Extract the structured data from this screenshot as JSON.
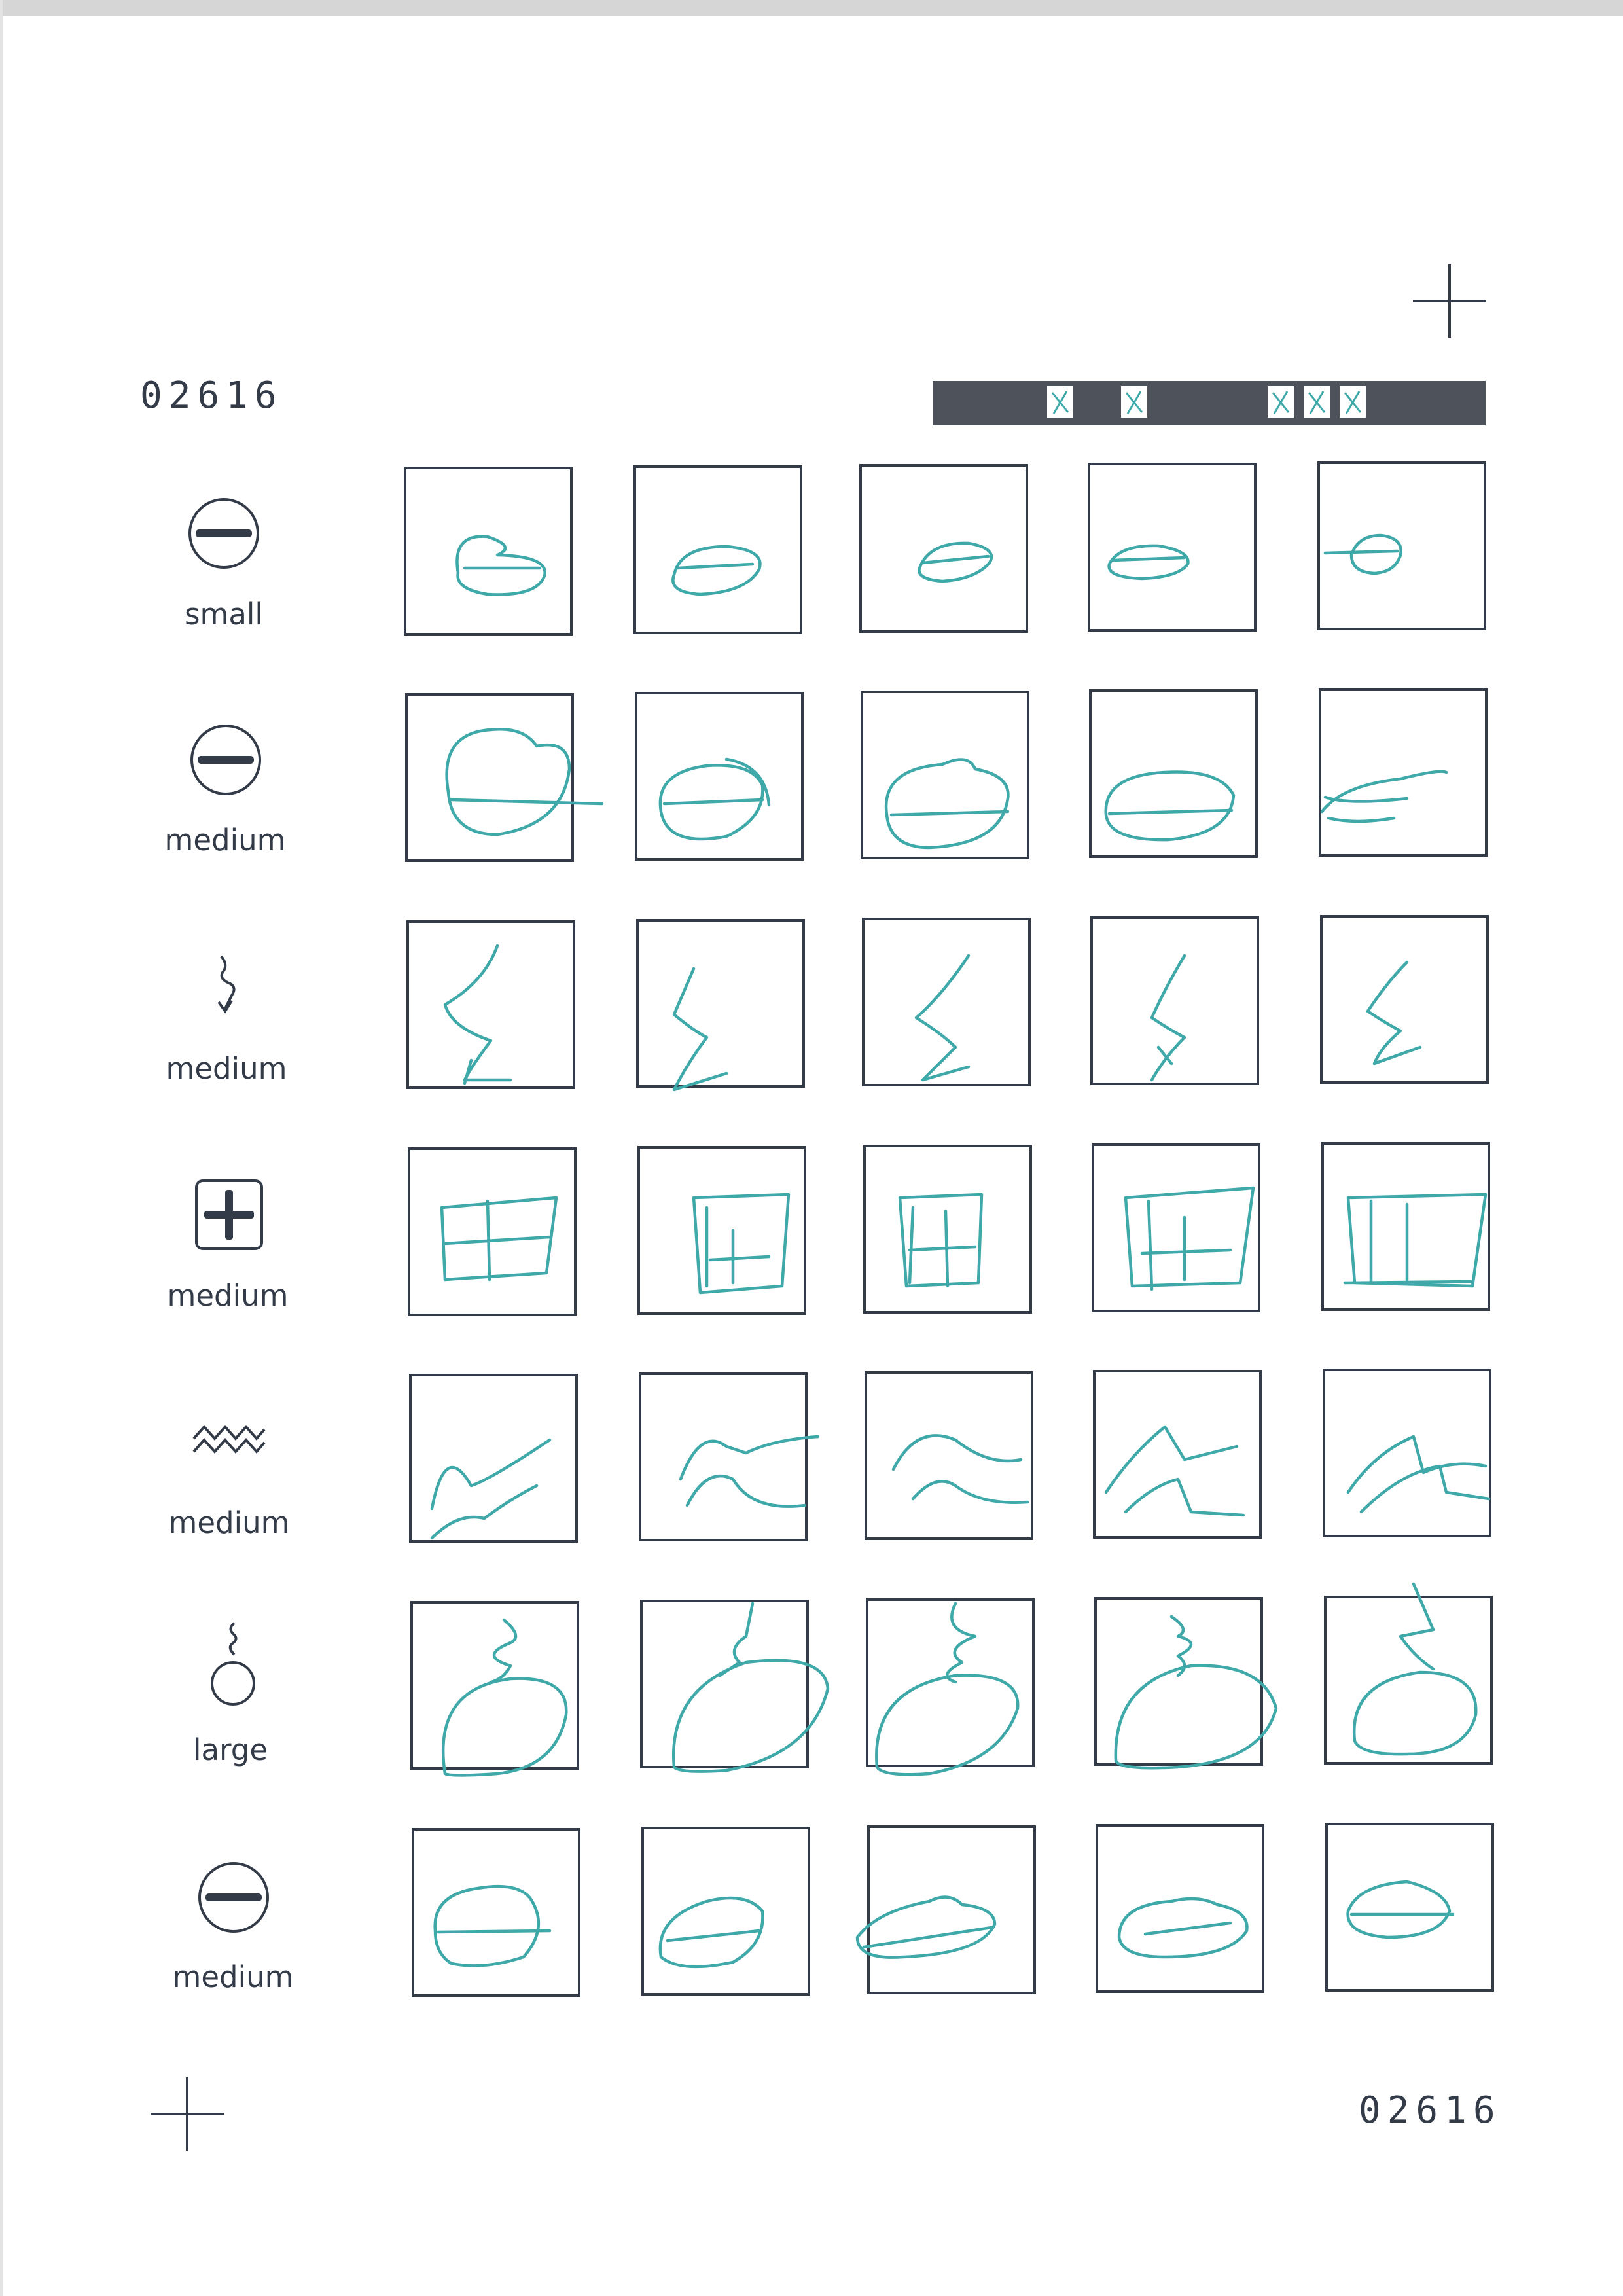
{
  "form": {
    "id_top": "02616",
    "id_bottom": "02616",
    "ink_color": "#3fa8a8",
    "line_color": "#333a48",
    "bar_color": "#4d525b"
  },
  "rows": [
    {
      "symbol": "circle-minus-icon",
      "label": "small"
    },
    {
      "symbol": "circle-minus-icon",
      "label": "medium"
    },
    {
      "symbol": "lightning-arrow-icon",
      "label": "medium"
    },
    {
      "symbol": "square-plus-icon",
      "label": "medium"
    },
    {
      "symbol": "zigzag-icon",
      "label": "medium"
    },
    {
      "symbol": "bomb-fuse-icon",
      "label": "large"
    },
    {
      "symbol": "circle-minus-icon",
      "label": "medium"
    }
  ]
}
